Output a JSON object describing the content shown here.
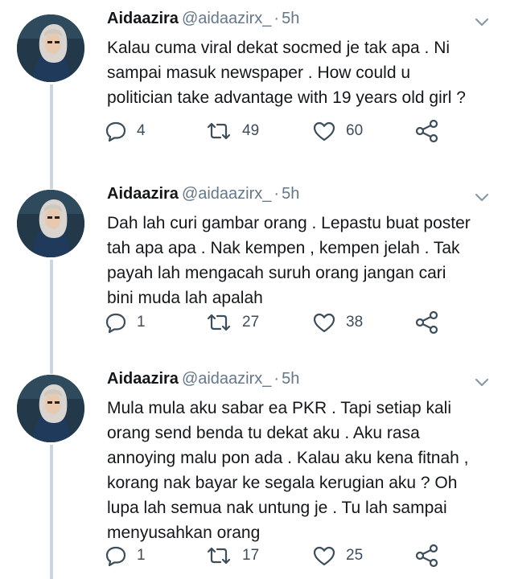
{
  "tweets": [
    {
      "name": "Aidaazira",
      "handle": "@aidaazirx_",
      "separator": "·",
      "time": "5h",
      "lines": [
        "Kalau cuma viral dekat socmed je tak apa . Ni",
        "sampai masuk newspaper . How could u",
        "politician take advantage with 19 years old girl ?"
      ],
      "replies": "4",
      "retweets": "49",
      "likes": "60"
    },
    {
      "name": "Aidaazira",
      "handle": "@aidaazirx_",
      "separator": "·",
      "time": "5h",
      "lines": [
        "Dah lah curi gambar orang . Lepastu buat poster",
        "tah apa apa . Nak kempen , kempen jelah . Tak",
        "payah lah mengacah suruh orang jangan cari",
        "bini muda lah apalah"
      ],
      "replies": "1",
      "retweets": "27",
      "likes": "38"
    },
    {
      "name": "Aidaazira",
      "handle": "@aidaazirx_",
      "separator": "·",
      "time": "5h",
      "lines": [
        "Mula mula aku sabar ea PKR . Tapi setiap kali",
        "orang send benda tu dekat aku . Aku rasa",
        "annoying malu pon ada . Kalau aku kena fitnah ,",
        "korang nak bayar ke segala kerugian aku ? Oh",
        "lupa lah semua nak untung je . Tu lah sampai",
        "menyusahkan orang"
      ],
      "replies": "1",
      "retweets": "17",
      "likes": "25"
    }
  ],
  "icons": {
    "reply": "reply-icon",
    "retweet": "retweet-icon",
    "like": "heart-icon",
    "share": "share-icon",
    "menu": "chevron-down-icon",
    "avatar": "avatar"
  },
  "colors": {
    "text": "#14171a",
    "secondary": "#657786",
    "icon": "#3d4d5a",
    "thread_line": "#ccd6dd"
  }
}
